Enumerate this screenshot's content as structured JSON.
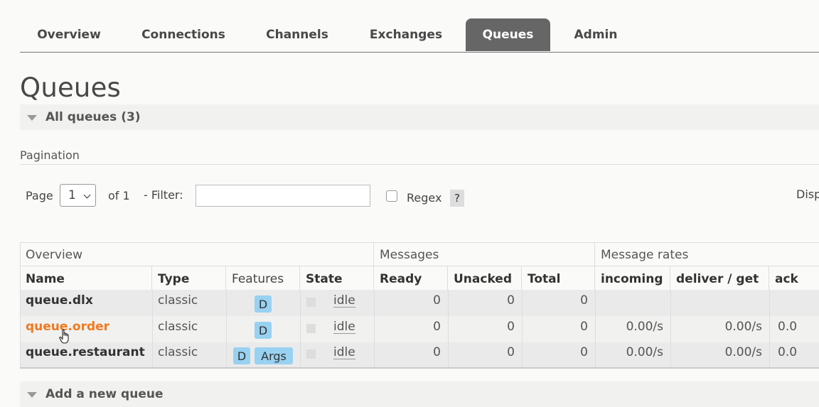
{
  "nav": {
    "tabs": [
      {
        "label": "Overview"
      },
      {
        "label": "Connections"
      },
      {
        "label": "Channels"
      },
      {
        "label": "Exchanges"
      },
      {
        "label": "Queues",
        "active": true
      },
      {
        "label": "Admin"
      }
    ]
  },
  "page_title": "Queues",
  "all_queues": {
    "label": "All queues (3)"
  },
  "pagination": {
    "section_label": "Pagination",
    "page_label": "Page",
    "page_value": "1",
    "of_label": "of 1",
    "filter_label": "- Filter:",
    "filter_value": "",
    "regex_label": "Regex",
    "help_label": "?",
    "display_label": "Disp"
  },
  "table": {
    "groups": {
      "overview": "Overview",
      "messages": "Messages",
      "rates": "Message rates"
    },
    "columns": {
      "name": "Name",
      "type": "Type",
      "features": "Features",
      "state": "State",
      "ready": "Ready",
      "unacked": "Unacked",
      "total": "Total",
      "incoming": "incoming",
      "deliver": "deliver / get",
      "ack": "ack"
    },
    "rows": [
      {
        "name": "queue.dlx",
        "type": "classic",
        "badge1": "D",
        "badge2": "",
        "state": "idle",
        "ready": "0",
        "unacked": "0",
        "total": "0",
        "incoming": "",
        "deliver": "",
        "ack": ""
      },
      {
        "name": "queue.order",
        "type": "classic",
        "badge1": "D",
        "badge2": "",
        "state": "idle",
        "ready": "0",
        "unacked": "0",
        "total": "0",
        "incoming": "0.00/s",
        "deliver": "0.00/s",
        "ack": "0.0"
      },
      {
        "name": "queue.restaurant",
        "type": "classic",
        "badge1": "D",
        "badge2": "Args",
        "state": "idle",
        "ready": "0",
        "unacked": "0",
        "total": "0",
        "incoming": "0.00/s",
        "deliver": "0.00/s",
        "ack": "0.0"
      }
    ]
  },
  "add_queue": {
    "label": "Add a new queue"
  },
  "colors": {
    "active_tab": "#666666",
    "link_hover": "#f0791e",
    "badge": "#98d1f1"
  }
}
